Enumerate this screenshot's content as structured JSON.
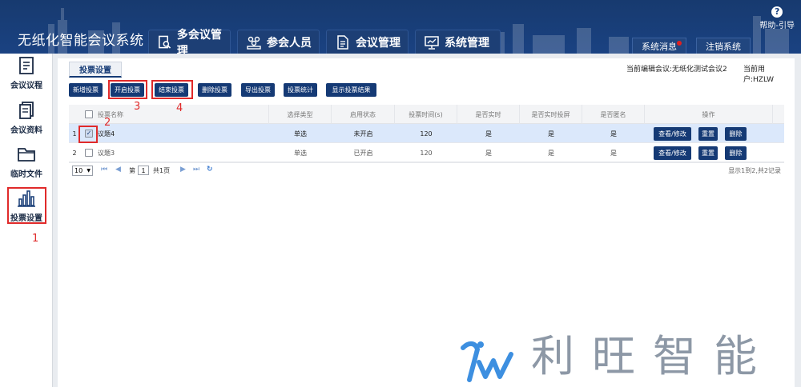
{
  "app": {
    "title": "无纸化智能会议系统"
  },
  "nav_tabs": [
    {
      "label": "多会议管理",
      "icon": "search-doc-icon"
    },
    {
      "label": "参会人员",
      "icon": "people-icon"
    },
    {
      "label": "会议管理",
      "icon": "document-icon"
    },
    {
      "label": "系统管理",
      "icon": "monitor-icon"
    }
  ],
  "header": {
    "messages_label": "系统消息",
    "logout_label": "注销系统",
    "help_icon_glyph": "?",
    "help_label": "帮助-引导"
  },
  "sidebar": {
    "items": [
      {
        "label": "会议议程",
        "icon": "agenda-icon"
      },
      {
        "label": "会议资料",
        "icon": "documents-icon"
      },
      {
        "label": "临时文件",
        "icon": "folder-icon"
      },
      {
        "label": "投票设置",
        "icon": "bar-chart-icon"
      }
    ]
  },
  "panel": {
    "tab_label": "投票设置",
    "current_meeting": "当前编辑会议:无纸化测试会议2",
    "current_user": "当前用户:HZLW"
  },
  "toolbar": {
    "buttons": [
      "新增投票",
      "开启投票",
      "结束投票",
      "删除投票",
      "导出投票",
      "投票统计",
      "显示投票结果"
    ]
  },
  "table": {
    "columns": [
      "投票名称",
      "选择类型",
      "启用状态",
      "投票时间(s)",
      "是否实时",
      "是否实时投屏",
      "是否匿名",
      "操作"
    ],
    "rows": [
      {
        "index": "1",
        "checked": true,
        "name": "议题4",
        "type": "单选",
        "status": "未开启",
        "time": "120",
        "realtime": "是",
        "realtime_screen": "是",
        "anonymous": "是"
      },
      {
        "index": "2",
        "checked": false,
        "name": "议题3",
        "type": "单选",
        "status": "已开启",
        "time": "120",
        "realtime": "是",
        "realtime_screen": "是",
        "anonymous": "是"
      }
    ],
    "row_actions": {
      "view_edit": "查看/修改",
      "reset": "重置",
      "delete": "删除"
    },
    "check_glyph": "✓"
  },
  "pager": {
    "page_size": "10",
    "page_prefix": "第",
    "page_value": "1",
    "page_suffix": "共1页",
    "summary": "显示1到2,共2记录",
    "first": "⏮",
    "prev": "◀",
    "next": "▶",
    "last": "⏭",
    "refresh": "↻"
  },
  "annotations": {
    "sidebar_step": "1",
    "checkbox_step": "2",
    "start_vote_step": "3",
    "end_vote_step": "4"
  },
  "watermark": {
    "brand_text": "利旺智能"
  },
  "colors": {
    "header_blue": "#1a4282",
    "button_blue": "#153a75",
    "annotation_red": "#e02a2a",
    "selected_row": "#dbe8fb"
  }
}
